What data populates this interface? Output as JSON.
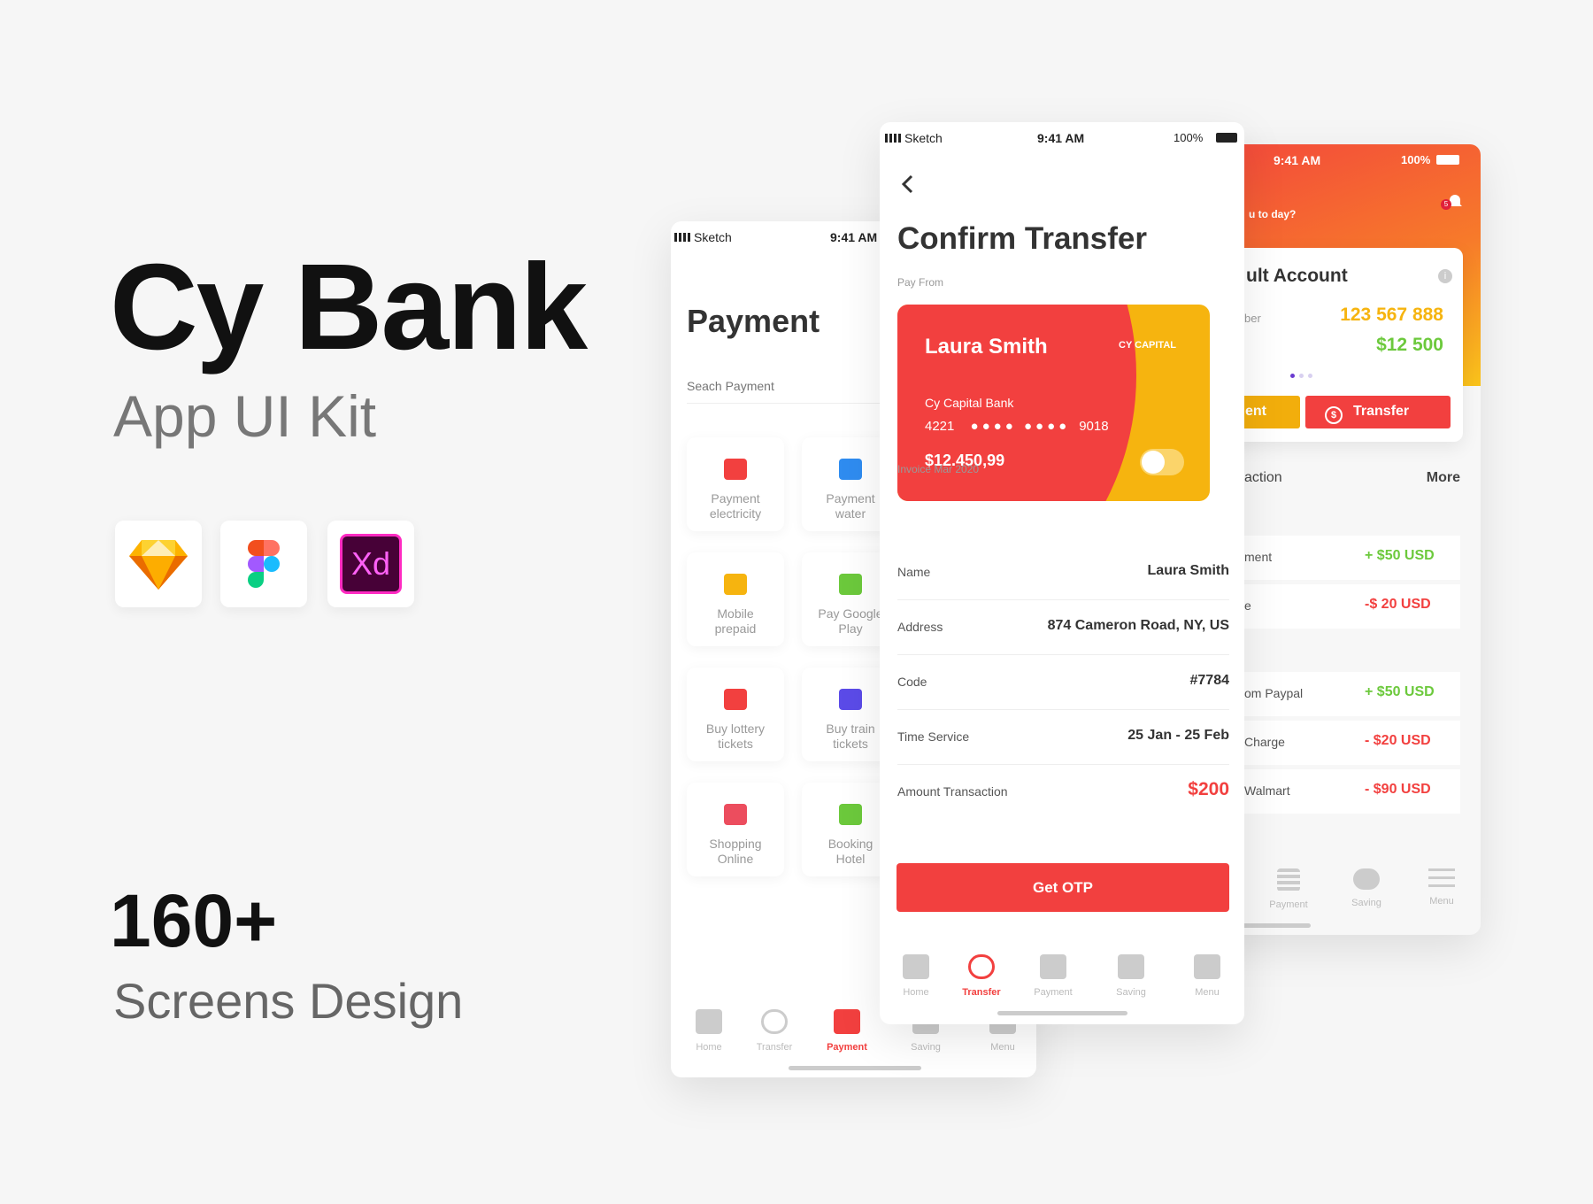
{
  "hero": {
    "title": "Cy Bank",
    "subtitle": "App UI Kit",
    "count": "160+",
    "count_label": "Screens Design",
    "tools": [
      "sketch-icon",
      "figma-icon",
      "xd-icon"
    ],
    "xd_label": "Xd"
  },
  "colors": {
    "accent": "#F2403F",
    "yellow": "#F6B40F",
    "green": "#6CC93C",
    "text": "#333333"
  },
  "status": {
    "carrier": "Sketch",
    "time": "9:41 AM",
    "battery": "100%"
  },
  "payment_screen": {
    "title": "Payment",
    "search_placeholder": "Seach Payment",
    "tiles": [
      {
        "l1": "Payment",
        "l2": "electricity",
        "icon": "plug-icon",
        "color": "#F2403F"
      },
      {
        "l1": "Payment",
        "l2": "water",
        "icon": "water-drop-icon",
        "color": "#2F8CF0"
      },
      {
        "l1": "Mobile",
        "l2": "prepaid",
        "icon": "dollar-phone-icon",
        "color": "#F6B40F"
      },
      {
        "l1": "Pay Google",
        "l2": "Play",
        "icon": "google-play-icon",
        "color": "#6CC93C"
      },
      {
        "l1": "Buy lottery",
        "l2": "tickets",
        "icon": "ticket-icon",
        "color": "#F2403F"
      },
      {
        "l1": "Buy train",
        "l2": "tickets",
        "icon": "train-icon",
        "color": "#5B4BE8"
      },
      {
        "l1": "Shopping",
        "l2": "Online",
        "icon": "cart-icon",
        "color": "#EC4D5E"
      },
      {
        "l1": "Booking",
        "l2": "Hotel",
        "icon": "hotel-icon",
        "color": "#6CC93C"
      }
    ],
    "tabs": [
      "Home",
      "Transfer",
      "Payment",
      "Saving",
      "Menu"
    ],
    "active_tab": "Payment"
  },
  "confirm_screen": {
    "title": "Confirm Transfer",
    "pay_from": "Pay From",
    "card": {
      "holder": "Laura Smith",
      "brand": "CY CAPITAL",
      "bank": "Cy Capital Bank",
      "number_start": "4221",
      "number_end": "9018",
      "balance": "$12.450,99"
    },
    "invoice": "Invoice Mar 2020",
    "rows": [
      {
        "k": "Name",
        "v": "Laura Smith"
      },
      {
        "k": "Address",
        "v": "874  Cameron Road, NY, US"
      },
      {
        "k": "Code",
        "v": "#7784"
      },
      {
        "k": "Time Service",
        "v": "25 Jan  - 25 Feb"
      },
      {
        "k": "Amount Transaction",
        "v": "$200"
      }
    ],
    "button": "Get OTP",
    "tabs": [
      "Home",
      "Transfer",
      "Payment",
      "Saving",
      "Menu"
    ],
    "active_tab": "Transfer"
  },
  "home_screen": {
    "greeting": "u to day?",
    "notification_count": "5",
    "account_title": "ult Account",
    "number_label": "ber",
    "account_number": "123 567 888",
    "balance": "$12 500",
    "btn_payment": "ent",
    "btn_transfer": "Transfer",
    "section": "action",
    "more": "More",
    "transactions": [
      [
        {
          "k": "ment",
          "v": "+ $50 USD",
          "pos": true
        },
        {
          "k": "e",
          "v": "-$ 20 USD",
          "pos": false
        }
      ],
      [
        {
          "k": "om Paypal",
          "v": "+ $50 USD",
          "pos": true
        },
        {
          "k": "Charge",
          "v": "- $20 USD",
          "pos": false
        },
        {
          "k": "Walmart",
          "v": "- $90 USD",
          "pos": false
        }
      ]
    ],
    "tabs": [
      "Payment",
      "Saving",
      "Menu"
    ]
  }
}
